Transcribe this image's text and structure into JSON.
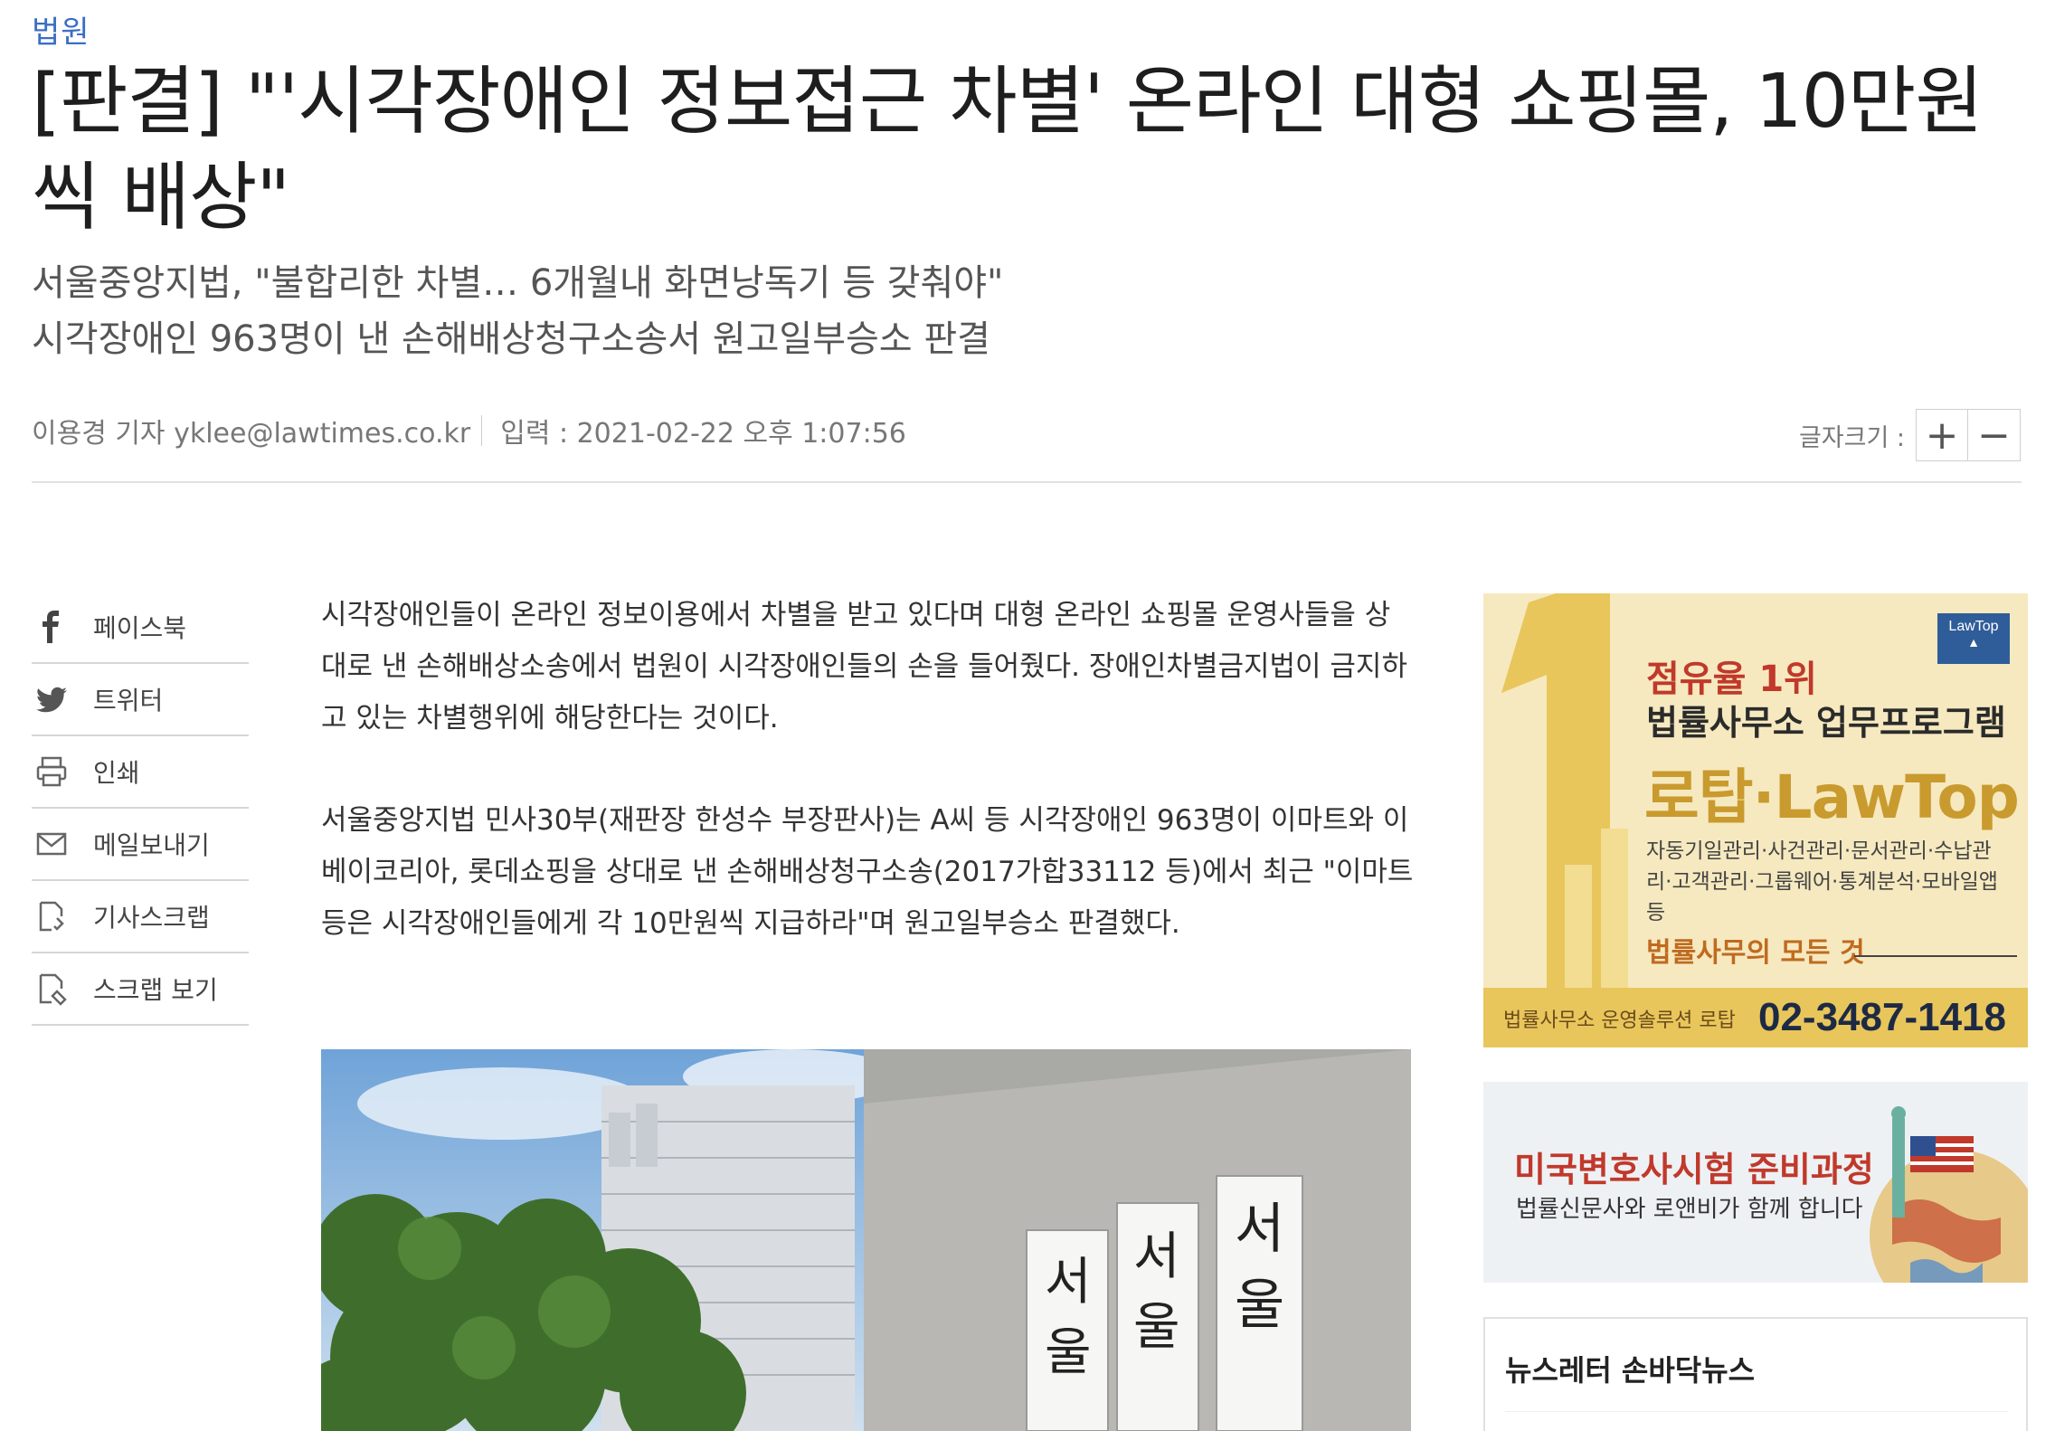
{
  "article": {
    "category": "법원",
    "headline": "[판결] \"'시각장애인 정보접근 차별' 온라인 대형 쇼핑몰, 10만원씩 배상\"",
    "subtitle_lines": [
      "서울중앙지법, \"불합리한 차별… 6개월내 화면낭독기 등 갖춰야\"",
      "시각장애인 963명이 낸 손해배상청구소송서 원고일부승소 판결"
    ],
    "byline": {
      "author": "이용경 기자 yklee@lawtimes.co.kr",
      "published": "입력 : 2021-02-22 오후 1:07:56"
    },
    "font_size_control": {
      "label": "글자크기 :",
      "increase": "+",
      "decrease": "−"
    },
    "paragraphs": [
      "시각장애인들이 온라인 정보이용에서 차별을 받고 있다며 대형 온라인 쇼핑몰 운영사들을 상대로 낸 손해배상소송에서 법원이 시각장애인들의 손을 들어줬다. 장애인차별금지법이 금지하고 있는 차별행위에 해당한다는 것이다.",
      "서울중앙지법 민사30부(재판장 한성수 부장판사)는 A씨 등 시각장애인 963명이 이마트와 이베이코리아, 롯데쇼핑을 상대로 낸 손해배상청구소송(2017가합33112 등)에서 최근 \"이마트 등은 시각장애인들에게 각 10만원씩 지급하라\"며 원고일부승소 판결했다."
    ],
    "photo_sign_chars": [
      "서",
      "서",
      "서",
      "울",
      "울",
      "울"
    ]
  },
  "share_menu": [
    {
      "label": "페이스북",
      "icon": "facebook-icon"
    },
    {
      "label": "트위터",
      "icon": "twitter-icon"
    },
    {
      "label": "인쇄",
      "icon": "print-icon"
    },
    {
      "label": "메일보내기",
      "icon": "mail-icon"
    },
    {
      "label": "기사스크랩",
      "icon": "scrap-icon"
    },
    {
      "label": "스크랩 보기",
      "icon": "scrap-view-icon"
    }
  ],
  "ads": {
    "lawtop": {
      "badge": "LawTop",
      "line1": "점유율 1위",
      "line2": "법률사무소 업무프로그램",
      "line3": "로탑·LawTop",
      "features": "자동기일관리·사건관리·문서관리·수납관리·고객관리·그룹웨어·통계분석·모바일앱 등",
      "tagline": "법률사무의 모든 것",
      "footer": "법률사무소 운영솔루션 로탑",
      "phone": "02-3487-1418",
      "colors": {
        "bg": "#f6e9bf",
        "accent": "#c99a2e",
        "red": "#c0392b"
      }
    },
    "bar_exam": {
      "line1": "미국변호사시험 준비과정",
      "line2": "법률신문사와 로앤비가 함께 합니다"
    }
  },
  "newsletter": {
    "title": "뉴스레터 손바닥뉴스"
  }
}
